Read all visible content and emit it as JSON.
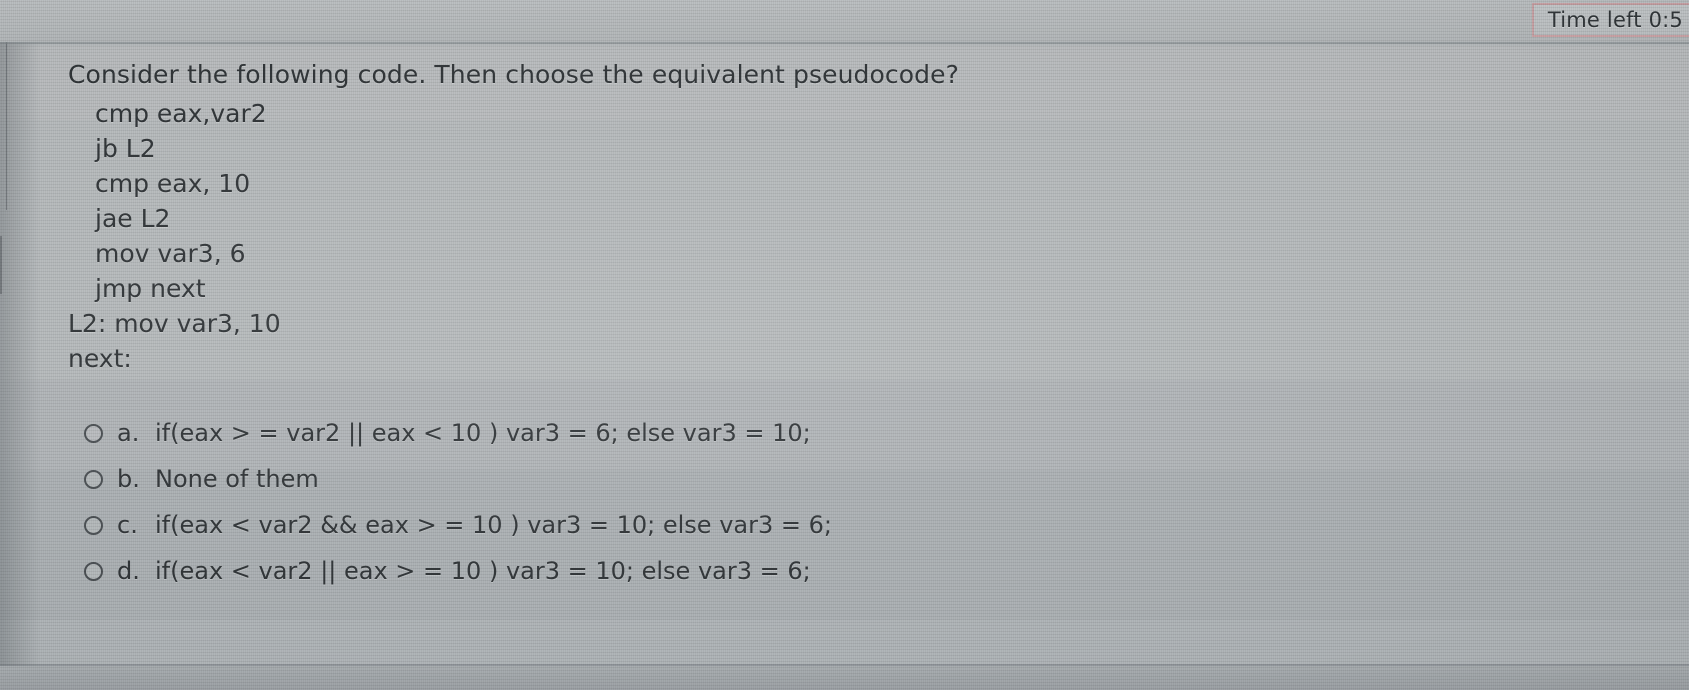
{
  "timer": {
    "label": "Time left 0:5"
  },
  "question": {
    "prompt": "Consider the following code. Then choose the equivalent pseudocode?",
    "code_lines": [
      {
        "text": "cmp eax,var2",
        "indent": true
      },
      {
        "text": "jb L2",
        "indent": true
      },
      {
        "text": "cmp eax, 10",
        "indent": true
      },
      {
        "text": "jae L2",
        "indent": true
      },
      {
        "text": "mov var3, 6",
        "indent": true
      },
      {
        "text": "jmp next",
        "indent": true
      },
      {
        "text": "L2: mov var3, 10",
        "indent": false
      },
      {
        "text": "next:",
        "indent": false
      }
    ]
  },
  "options": [
    {
      "letter": "a.",
      "text": "if(eax > = var2 || eax < 10 ) var3 = 6; else var3 = 10;",
      "selected": false
    },
    {
      "letter": "b.",
      "text": "None of them",
      "selected": false
    },
    {
      "letter": "c.",
      "text": "if(eax < var2 && eax > = 10 ) var3 = 10; else var3 = 6;",
      "selected": false
    },
    {
      "letter": "d.",
      "text": "if(eax < var2 || eax > = 10 ) var3 = 10; else var3 = 6;",
      "selected": false
    }
  ],
  "colors": {
    "screen_background": "#b4b8ba",
    "text": "#2e3336",
    "timer_border": "#c9a3a6",
    "radio_outline": "#4a4f53"
  }
}
